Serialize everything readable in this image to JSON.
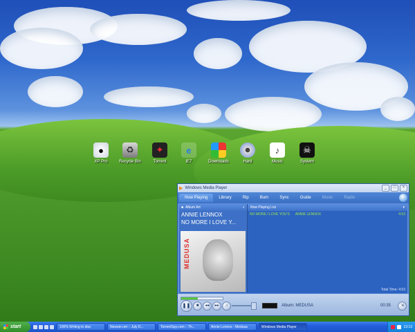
{
  "desktop": {
    "icons": [
      {
        "label": "XP Pro",
        "icon": "xp-pro-icon"
      },
      {
        "label": "Recycle Bin",
        "icon": "recycle-bin-icon"
      },
      {
        "label": "Torrent",
        "icon": "transformers-icon"
      },
      {
        "label": "IE7",
        "icon": "internet-explorer-icon"
      },
      {
        "label": "Downloads",
        "icon": "cube-icon"
      },
      {
        "label": "Hard",
        "icon": "disc-icon"
      },
      {
        "label": "Music",
        "icon": "music-file-icon"
      },
      {
        "label": "System",
        "icon": "pirate-flag-icon"
      }
    ]
  },
  "wmp": {
    "title": "Windows Media Player",
    "tabs": [
      "Now Playing",
      "Library",
      "Rip",
      "Burn",
      "Sync",
      "Guide",
      "Music",
      "Radio"
    ],
    "left_header": "Album Art",
    "artist": "ANNIE LENNOX",
    "album_line": "NO MORE I LOVE Y...",
    "art_text": "MEDUSA",
    "list_header": "Now Playing List",
    "track": {
      "title": "NO MORE I LOVE YOU'S",
      "artist": "ANNIE LENNOX",
      "duration": "4:53"
    },
    "total_time": "Total Time: 4:53",
    "status_album": "Album: MEDUSA",
    "status_time": "00:35",
    "seek_progress": 0.4
  },
  "taskbar": {
    "start_label": "start",
    "tasks": [
      "100% Writing to disc",
      "Neowin.net :: July D...",
      "TorrentSpy.com :: Th...",
      "Annie Lennox - Medusa",
      "Windows Media Player"
    ],
    "clock": "13:13"
  }
}
